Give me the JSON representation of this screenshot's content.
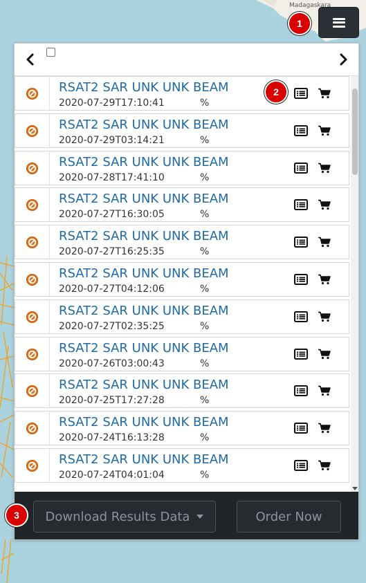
{
  "map": {
    "place_label": "Madagaskara"
  },
  "menu": {
    "icon": "hamburger-menu-icon"
  },
  "badges": [
    "1",
    "2",
    "3"
  ],
  "nav": {
    "prev_icon": "chevron-left-icon",
    "next_icon": "chevron-right-icon"
  },
  "results": [
    {
      "title": "RSAT2 SAR UNK UNK BEAM",
      "date": "2020-07-29T17:10:41",
      "pct": "%"
    },
    {
      "title": "RSAT2 SAR UNK UNK BEAM",
      "date": "2020-07-29T03:14:21",
      "pct": "%"
    },
    {
      "title": "RSAT2 SAR UNK UNK BEAM",
      "date": "2020-07-28T17:41:10",
      "pct": "%"
    },
    {
      "title": "RSAT2 SAR UNK UNK BEAM",
      "date": "2020-07-27T16:30:05",
      "pct": "%"
    },
    {
      "title": "RSAT2 SAR UNK UNK BEAM",
      "date": "2020-07-27T16:25:35",
      "pct": "%"
    },
    {
      "title": "RSAT2 SAR UNK UNK BEAM",
      "date": "2020-07-27T04:12:06",
      "pct": "%"
    },
    {
      "title": "RSAT2 SAR UNK UNK BEAM",
      "date": "2020-07-27T02:35:25",
      "pct": "%"
    },
    {
      "title": "RSAT2 SAR UNK UNK BEAM",
      "date": "2020-07-26T03:00:43",
      "pct": "%"
    },
    {
      "title": "RSAT2 SAR UNK UNK BEAM",
      "date": "2020-07-25T17:27:28",
      "pct": "%"
    },
    {
      "title": "RSAT2 SAR UNK UNK BEAM",
      "date": "2020-07-24T16:13:28",
      "pct": "%"
    },
    {
      "title": "RSAT2 SAR UNK UNK BEAM",
      "date": "2020-07-24T04:01:04",
      "pct": "%"
    }
  ],
  "footer": {
    "download_label": "Download Results Data",
    "order_label": "Order Now"
  },
  "colors": {
    "title_link": "#1f6aa5",
    "badge": "#d90000",
    "footer_bg": "#20252a",
    "no_preview": "#e06d12"
  }
}
